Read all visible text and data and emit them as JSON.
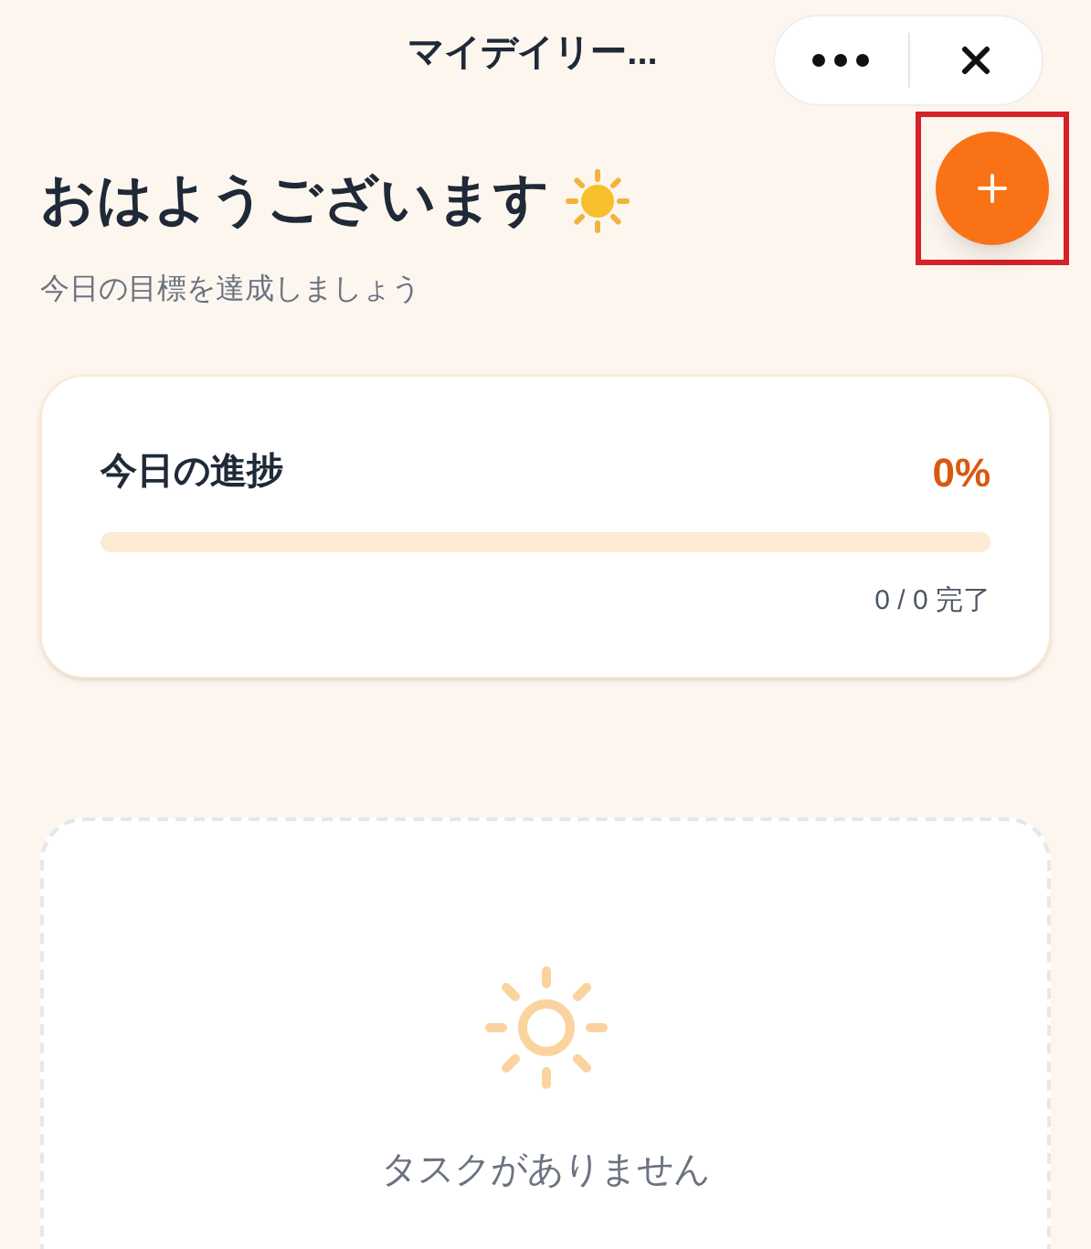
{
  "header": {
    "title": "マイデイリー..."
  },
  "greeting": {
    "title": "おはようございます",
    "subtitle": "今日の目標を達成しましょう"
  },
  "progress": {
    "title": "今日の進捗",
    "percent": "0%",
    "level": 0,
    "count": "0 / 0 完了"
  },
  "empty_state": {
    "message": "タスクがありません"
  }
}
